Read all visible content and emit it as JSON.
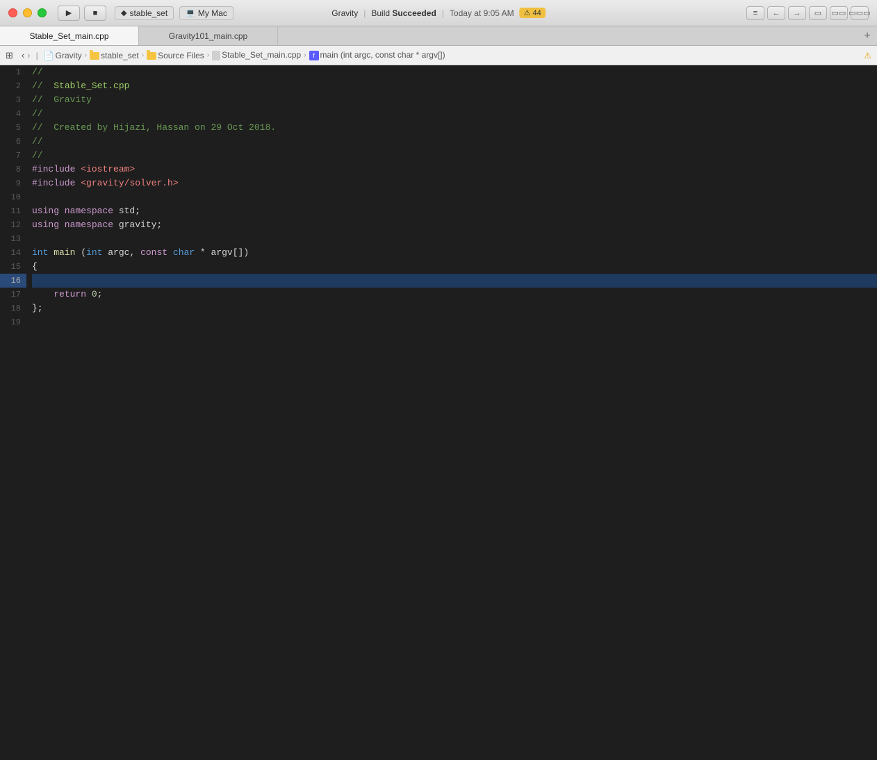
{
  "titlebar": {
    "app_name": "stable_set",
    "device": "My Mac",
    "build_label": "Gravity",
    "build_separator": "|",
    "build_status": "Build",
    "build_status_strong": "Succeeded",
    "timestamp": "Today at 9:05 AM",
    "warning_count": "44"
  },
  "tabs": [
    {
      "label": "Stable_Set_main.cpp",
      "active": true
    },
    {
      "label": "Gravity101_main.cpp",
      "active": false
    }
  ],
  "breadcrumb": {
    "items": [
      {
        "type": "project",
        "label": "Gravity"
      },
      {
        "type": "folder",
        "label": "stable_set"
      },
      {
        "type": "folder",
        "label": "Source Files"
      },
      {
        "type": "file",
        "label": "Stable_Set_main.cpp"
      },
      {
        "type": "function",
        "label": "main (int argc, const char * argv[])"
      }
    ]
  },
  "code": {
    "lines": [
      {
        "num": 1,
        "content": "//",
        "current": false
      },
      {
        "num": 2,
        "content": "//  Stable_Set.cpp",
        "current": false
      },
      {
        "num": 3,
        "content": "//  Gravity",
        "current": false
      },
      {
        "num": 4,
        "content": "//",
        "current": false
      },
      {
        "num": 5,
        "content": "//  Created by Hijazi, Hassan on 29 Oct 2018.",
        "current": false
      },
      {
        "num": 6,
        "content": "//",
        "current": false
      },
      {
        "num": 7,
        "content": "//",
        "current": false
      },
      {
        "num": 8,
        "content": "#include <iostream>",
        "current": false
      },
      {
        "num": 9,
        "content": "#include <gravity/solver.h>",
        "current": false
      },
      {
        "num": 10,
        "content": "",
        "current": false
      },
      {
        "num": 11,
        "content": "using namespace std;",
        "current": false
      },
      {
        "num": 12,
        "content": "using namespace gravity;",
        "current": false
      },
      {
        "num": 13,
        "content": "",
        "current": false
      },
      {
        "num": 14,
        "content": "int main (int argc, const char * argv[])",
        "current": false
      },
      {
        "num": 15,
        "content": "{",
        "current": false
      },
      {
        "num": 16,
        "content": "",
        "current": true
      },
      {
        "num": 17,
        "content": "    return 0;",
        "current": false
      },
      {
        "num": 18,
        "content": "};",
        "current": false
      },
      {
        "num": 19,
        "content": "",
        "current": false
      }
    ]
  }
}
